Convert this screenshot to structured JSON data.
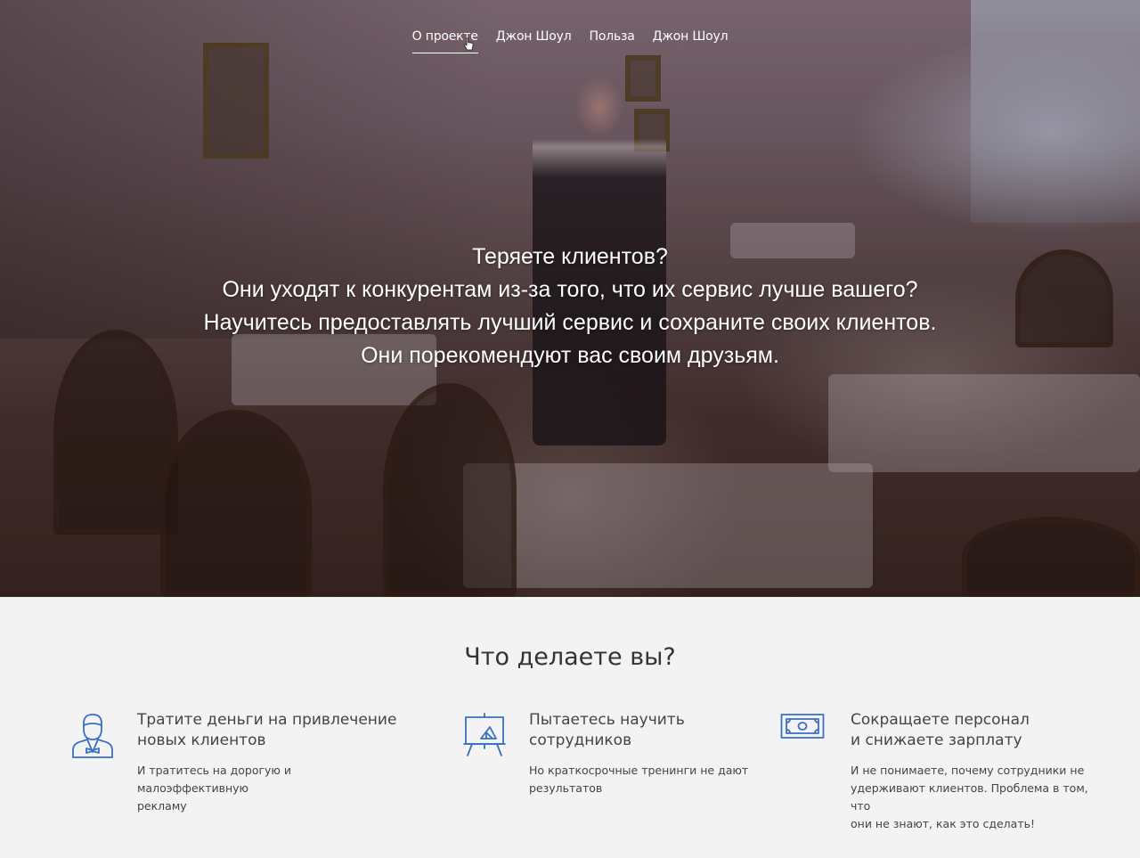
{
  "nav": {
    "items": [
      {
        "label": "О проекте",
        "active": true
      },
      {
        "label": "Джон Шоул",
        "active": false
      },
      {
        "label": "Польза",
        "active": false
      },
      {
        "label": "Джон Шоул",
        "active": false
      }
    ]
  },
  "hero": {
    "lines": [
      "Теряете клиентов?",
      "Они уходят к конкурентам из-за того, что их сервис лучше вашего?",
      "Научитесь предоставлять лучший сервис и сохраните своих клиентов.",
      "Они порекомендуют вас своим друзьям."
    ]
  },
  "features": {
    "heading": "Что делаете вы?",
    "accent_color": "#3a6fc4",
    "items": [
      {
        "icon": "businessman-icon",
        "title_lines": [
          "Тратите деньги на привлечение",
          "новых клиентов"
        ],
        "desc_lines": [
          "И тратитесь на дорогую и малоэффективную",
          "рекламу"
        ]
      },
      {
        "icon": "presentation-board-icon",
        "title_lines": [
          "Пытаетесь научить",
          "сотрудников"
        ],
        "desc_lines": [
          "Но краткосрочные тренинги не дают",
          "результатов"
        ]
      },
      {
        "icon": "banknote-icon",
        "title_lines": [
          "Сокращаете персонал",
          "и снижаете зарплату"
        ],
        "desc_lines": [
          "И не понимаете, почему сотрудники не",
          "удерживают клиентов. Проблема в том, что",
          "они не знают, как это сделать!"
        ]
      }
    ]
  }
}
